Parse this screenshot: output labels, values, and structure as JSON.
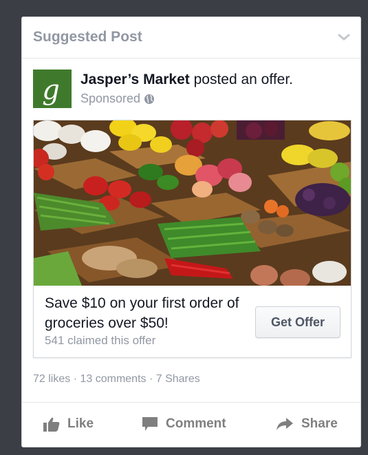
{
  "post": {
    "header_label": "Suggested Post",
    "page_name": "Jasper’s Market",
    "action_text": " posted an offer.",
    "sponsored_label": "Sponsored",
    "avatar_letter": "g"
  },
  "offer": {
    "text": "Save $10 on your first order of groceries over $50!",
    "claimed": "541 claimed this offer",
    "button_label": "Get Offer"
  },
  "stats": {
    "text": "72 likes · 13 comments · 7 Shares"
  },
  "actions": {
    "like": "Like",
    "comment": "Comment",
    "share": "Share"
  },
  "icons": {
    "chevron": "chevron-down-icon",
    "globe": "globe-icon",
    "like": "thumbs-up-icon",
    "comment": "comment-icon",
    "share": "share-arrow-icon"
  },
  "colors": {
    "background": "#3b3f45",
    "card": "#ffffff",
    "avatar": "#3f7a2c",
    "muted_text": "#9197a3",
    "action_text": "#7f7f7f"
  }
}
